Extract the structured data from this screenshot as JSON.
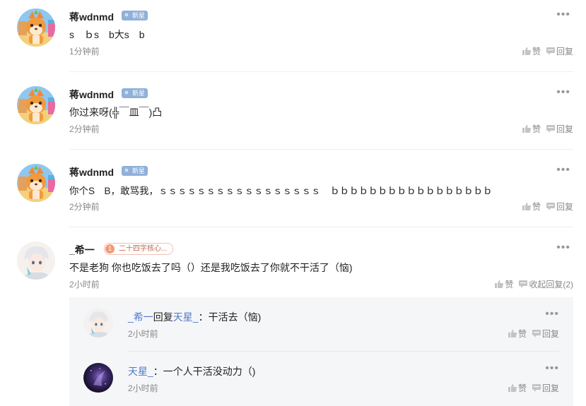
{
  "comments": [
    {
      "user": "蒋wdnmd",
      "badge": "新星",
      "text": "s　ｂs　b大s　b",
      "time": "1分钟前",
      "like_label": "赞",
      "reply_label": "回复"
    },
    {
      "user": "蒋wdnmd",
      "badge": "新星",
      "text": "你过来呀(╬￣皿￣)凸",
      "time": "2分钟前",
      "like_label": "赞",
      "reply_label": "回复"
    },
    {
      "user": "蒋wdnmd",
      "badge": "新星",
      "text": "你个S　B，敢骂我，ｓｓｓｓｓｓｓｓｓｓｓｓｓｓｓｓｓ　ｂｂｂｂｂｂｂｂｂｂｂｂｂｂｂｂｂ",
      "time": "2分钟前",
      "like_label": "赞",
      "reply_label": "回复"
    },
    {
      "user": "_希一",
      "badge_level": "1",
      "badge": "二十四字核心...",
      "text": "不是老狗 你也吃饭去了吗（）还是我吃饭去了你就不干活了（恼)",
      "time": "2小时前",
      "like_label": "赞",
      "collapse_label": "收起回复(2)"
    }
  ],
  "replies": [
    {
      "from": "_希一",
      "verb": "回复",
      "to": "天星_",
      "colon": "：",
      "text": "干活去（恼)",
      "time": "2小时前",
      "like_label": "赞",
      "reply_label": "回复"
    },
    {
      "from": "天星_",
      "colon": "：",
      "text": "一个人干活没动力（)",
      "time": "2小时前",
      "like_label": "赞",
      "reply_label": "回复"
    }
  ],
  "more_glyph": "•••",
  "icons": {
    "avatar": "fox-mascot-avatar",
    "like": "thumbs-up-icon",
    "reply": "speech-bubble-icon",
    "more": "more-dots-icon",
    "badge": "star-badge-icon"
  },
  "colors": {
    "link": "#5079c8",
    "badge_new": "#8fb0d9",
    "badge_level": "#f19a76"
  }
}
